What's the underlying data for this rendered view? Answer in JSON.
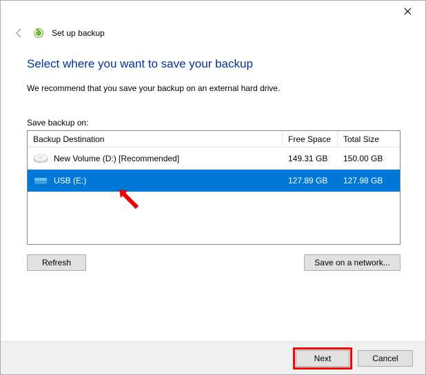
{
  "window": {
    "title": "Set up backup"
  },
  "content": {
    "heading": "Select where you want to save your backup",
    "recommendation": "We recommend that you save your backup on an external hard drive.",
    "save_label": "Save backup on:"
  },
  "table": {
    "columns": {
      "destination": "Backup Destination",
      "free_space": "Free Space",
      "total_size": "Total Size"
    },
    "rows": [
      {
        "name": "New Volume (D:) [Recommended]",
        "free": "149.31 GB",
        "total": "150.00 GB",
        "selected": false,
        "icon": "hdd"
      },
      {
        "name": "USB (E:)",
        "free": "127.89 GB",
        "total": "127.98 GB",
        "selected": true,
        "icon": "usb"
      }
    ]
  },
  "buttons": {
    "refresh": "Refresh",
    "save_network": "Save on a network...",
    "next": "Next",
    "cancel": "Cancel"
  }
}
